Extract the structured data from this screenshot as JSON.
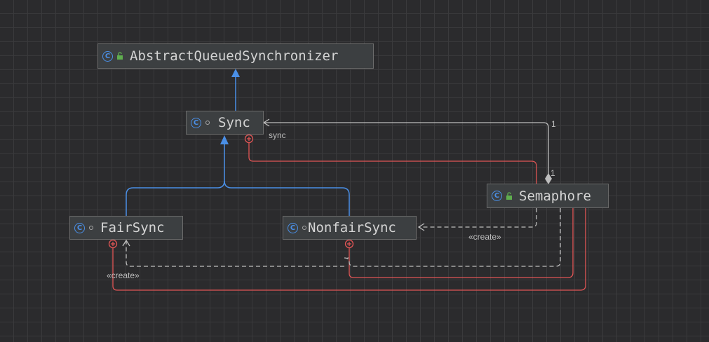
{
  "diagram": {
    "nodes": {
      "aqs": {
        "label": "AbstractQueuedSynchronizer",
        "icon": "class-icon",
        "visibility": "public-lock-icon"
      },
      "sync": {
        "label": "Sync",
        "icon": "class-icon",
        "visibility": "package-private-dot-icon"
      },
      "fairsync": {
        "label": "FairSync",
        "icon": "class-icon",
        "visibility": "package-private-dot-icon"
      },
      "nonfairsync": {
        "label": "NonfairSync",
        "icon": "class-icon",
        "visibility": "package-private-dot-icon"
      },
      "semaphore": {
        "label": "Semaphore",
        "icon": "class-icon",
        "visibility": "public-lock-icon"
      }
    },
    "edge_labels": {
      "sync_field": "sync",
      "multiplicity_target": "1",
      "multiplicity_source": "1",
      "create_nonfair": "«create»",
      "create_fair": "«create»"
    },
    "colors": {
      "background": "#2b2b2d",
      "inheritance": "#4a8fe6",
      "association": "#bdbdbd",
      "inner_class": "#e05555",
      "dependency": "#bdbdbd",
      "node_fill": "#3c3f41",
      "node_border": "#6b6b6b"
    }
  }
}
